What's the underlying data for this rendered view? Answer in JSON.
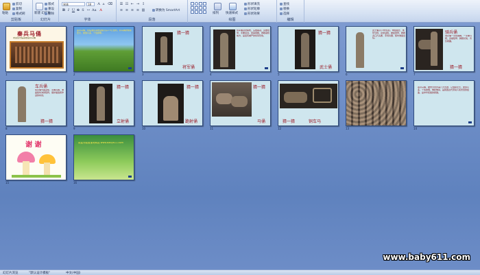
{
  "ribbon": {
    "groups": [
      "剪贴板",
      "幻灯片",
      "字体",
      "段落",
      "绘图",
      "编辑"
    ],
    "buttons": {
      "paste": "粘贴",
      "new_slide": "新建\n幻灯片",
      "layout": "版式",
      "reset": "重设",
      "delete": "删除",
      "quick_styles": "快速样式",
      "arrange": "排列",
      "find": "查找",
      "replace": "替换",
      "select": "选择",
      "convert_smartart": "转换为 SmartArt",
      "shape_fill": "形状填充",
      "shape_outline": "形状轮廓",
      "shape_effects": "形状效果",
      "cut": "剪切",
      "copy": "复制",
      "format_painter": "格式刷"
    },
    "font_name": "宋体",
    "font_size": "18"
  },
  "slides": [
    {
      "num": "1",
      "title": "秦兵马俑",
      "subtitle": "欢迎您光临秦始皇兵马俑"
    },
    {
      "num": "2",
      "text": "秦兵马俑，在临潼区秦始皇陵以东1.5公里处。兵马俑的规模宏大、类型众多、个性鲜明..."
    },
    {
      "num": "3",
      "title": "猜一猜",
      "caption": "将军俑"
    },
    {
      "num": "4",
      "text": "将军俑身材魁梧，头戴鹖冠，身披铠甲，手握宝剑，昂首挺胸，两眼凝视前方，是最有威严的将军形象。"
    },
    {
      "num": "5",
      "title": "猜一猜",
      "caption": "武士俑"
    },
    {
      "num": "6",
      "text": "武士俑高1.8米左右，体格健壮，体形匀称，身穿战袍，披挂铠甲，脚蹬方口齐头履，手持兵器，随时准备出征。"
    },
    {
      "num": "7",
      "title": "骑兵俑",
      "text": "骑兵俑一手执缰绳，一手握弓箭，身着短甲，脚蹬长靴，背负箭囊。",
      "caption": "猜一猜"
    },
    {
      "num": "8",
      "title": "车兵俑",
      "text": "车兵俑驾着战车，手握兵器，准备随时冲锋陷阵，保护着指挥作战的将领。",
      "caption": "猜一猜"
    },
    {
      "num": "9",
      "title": "猜一猜",
      "caption": "立射俑"
    },
    {
      "num": "10",
      "title": "猜一猜",
      "caption": "跪射俑"
    },
    {
      "num": "11",
      "title": "猜一猜",
      "caption": "马俑"
    },
    {
      "num": "12",
      "title": "猜一猜",
      "caption": "铜车马"
    },
    {
      "num": "13"
    },
    {
      "num": "14",
      "text": "秦兵马俑，被誉为世界第八大奇迹，它规模宏大，类型众多，个性鲜明，惟妙惟肖，是我国古代劳动人民智慧的结晶，是中华民族的骄傲。"
    },
    {
      "num": "15",
      "title": "谢 谢"
    },
    {
      "num": "16",
      "text": "欢迎光临宝宝吧网站 www.baby611.com"
    }
  ],
  "watermark": "www.baby611.com",
  "status": {
    "view": "幻灯片浏览",
    "theme": "\"默认设计模板\"",
    "language": "中文(中国)"
  },
  "colors": {
    "slide_bg": "#cfe6ee",
    "accent_red": "#9b1c28",
    "workspace": "#6f8fc4"
  }
}
